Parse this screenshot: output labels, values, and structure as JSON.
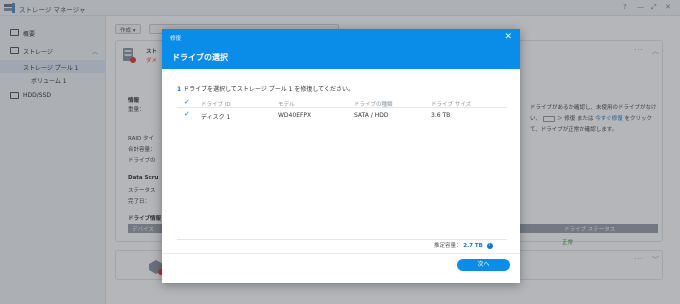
{
  "window": {
    "title": "ストレージ マネージャ",
    "controls": [
      "?",
      "—",
      "⤢",
      "✕"
    ]
  },
  "sidebar": {
    "items": [
      {
        "label": "概要"
      },
      {
        "label": "ストレージ"
      },
      {
        "label": "ストレージ プール 1"
      },
      {
        "label": "ボリューム 1"
      },
      {
        "label": "HDD/SSD"
      }
    ]
  },
  "toolbar": {
    "create_label": "作成 ▾"
  },
  "background": {
    "card_title": "スト",
    "card_subtitle": "ダメ",
    "info_heading": "情報",
    "info_label": "重量：",
    "raid_label": "RAID タイ",
    "total_label": "合計容量：",
    "drive_label": "ドライブの",
    "scrub_heading": "Data Scru",
    "status_label": "ステータス",
    "complete_label": "完了日：",
    "drive_info_label": "ドライブ情報",
    "device_col": "デバイス",
    "side_text_1": "ドライブがあるか確認し、未使用のドライブがなけ",
    "side_text_2a": "い、",
    "side_text_2b": "＞ 修復 または ",
    "side_text_2_link": "今すぐ修復",
    "side_text_2c": " をクリック",
    "side_text_3": "て、ドライブが正常か確認します。",
    "drive_status_col": "ドライブ ステータス",
    "drive_status_value": "正常"
  },
  "modal": {
    "category": "修復",
    "title": "ドライブの選択",
    "close_glyph": "✕",
    "description_count": "1",
    "description_text": " ドライブを選択してストレージ プール 1 を修復してください。",
    "table": {
      "columns": [
        "ドライブ ID",
        "モデル",
        "ドライブの種類",
        "ドライブ サイズ"
      ],
      "rows": [
        {
          "id": "ディスク 1",
          "model": "WD40EFPX",
          "type": "SATA / HDD",
          "size": "3.6 TB",
          "selected": true
        }
      ]
    },
    "estimated_label": "推定容量：",
    "estimated_value": "2.7 TB",
    "info_glyph": "i",
    "next_label": "次へ"
  }
}
